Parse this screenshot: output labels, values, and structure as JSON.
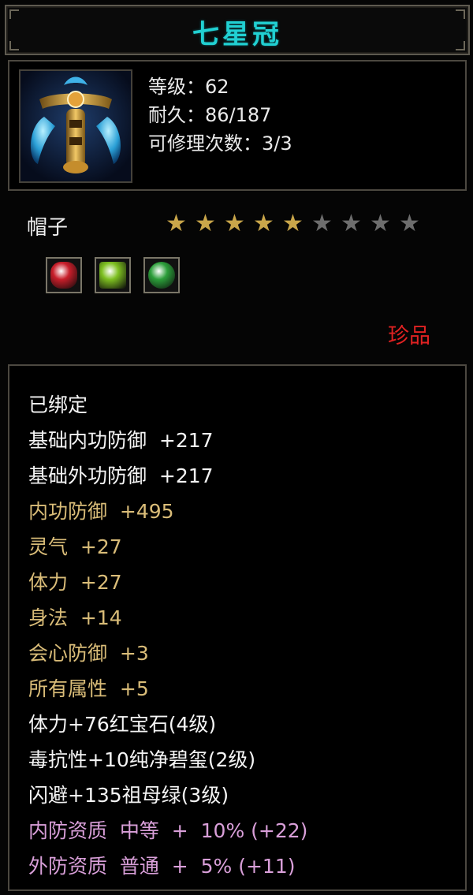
{
  "item": {
    "name": "七星冠",
    "level_label": "等级：62",
    "durability_label": "耐久：86/187",
    "repair_label": "可修理次数：3/3",
    "type": "帽子",
    "rarity": "珍品",
    "stars": {
      "filled": 5,
      "total": 9
    },
    "gem_slots": [
      {
        "name": "ruby-gem-icon",
        "color": "#c81e2a"
      },
      {
        "name": "pure-jade-gem-icon",
        "color": "#7ec021"
      },
      {
        "name": "emerald-gem-icon",
        "color": "#2c9e3a"
      }
    ]
  },
  "attributes": [
    {
      "text": "已绑定",
      "color": "white"
    },
    {
      "text": "基础内功防御  +217",
      "color": "white"
    },
    {
      "text": "基础外功防御  +217",
      "color": "white"
    },
    {
      "text": "内功防御  +495",
      "color": "gold"
    },
    {
      "text": "灵气  +27",
      "color": "gold"
    },
    {
      "text": "体力  +27",
      "color": "gold"
    },
    {
      "text": "身法  +14",
      "color": "gold"
    },
    {
      "text": "会心防御  +3",
      "color": "gold"
    },
    {
      "text": "所有属性  +5",
      "color": "gold"
    },
    {
      "text": "体力+76红宝石(4级)",
      "color": "white"
    },
    {
      "text": "毒抗性+10纯净碧玺(2级)",
      "color": "white"
    },
    {
      "text": "闪避+135祖母绿(3级)",
      "color": "white"
    },
    {
      "text": "内防资质  中等  +  10% (+22)",
      "color": "pink"
    },
    {
      "text": "外防资质  普通  +  5% (+11)",
      "color": "pink"
    }
  ],
  "colors": {
    "title": "#21d0d2",
    "rarity": "#e02222",
    "star_filled": "#c9a64a",
    "star_empty": "#6d6d6d"
  }
}
